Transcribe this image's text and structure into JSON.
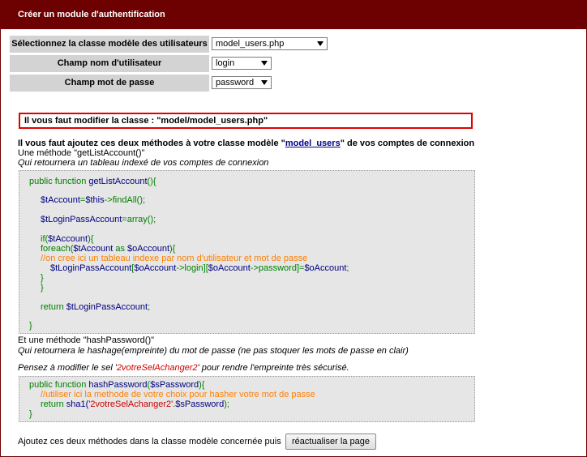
{
  "header": {
    "title": "Créer un module d'authentification"
  },
  "form": {
    "model_label": "Sélectionnez la classe modèle des utilisateurs",
    "model_value": "model_users.php",
    "username_label": "Champ nom d'utilisateur",
    "username_value": "login",
    "password_label": "Champ mot de passe",
    "password_value": "password"
  },
  "warning": "Il vous faut modifier la classe : \"model/model_users.php\"",
  "intro": {
    "part1": "Il vous faut ajoutez ces deux méthodes à votre classe modèle \"",
    "link": "model_users",
    "part2": "\" de vos comptes de connexion",
    "method1_title": "Une méthode \"getListAccount()\"",
    "method1_desc": "Qui retournera un tableau indexé de vos comptes de connexion"
  },
  "code1": {
    "l1a": "public function ",
    "l1b": "getListAccount",
    "l1c": "(){",
    "l2a": "$tAccount",
    "l2b": "=",
    "l2c": "$this",
    "l2d": "->findAll();",
    "l3a": "$tLoginPassAccount",
    "l3b": "=array();",
    "l4a": "if(",
    "l4b": "$tAccount",
    "l4c": "){",
    "l5a": "foreach(",
    "l5b": "$tAccount",
    "l5c": " as ",
    "l5d": "$oAccount",
    "l5e": "){",
    "l6": "//on cree ici un tableau indexe par nom d'utilisateur et mot de passe",
    "l7a": "$tLoginPassAccount",
    "l7b": "[",
    "l7c": "$oAccount",
    "l7d": "->login][",
    "l7e": "$oAccount",
    "l7f": "->password]=",
    "l7g": "$oAccount",
    "l7h": ";",
    "l8": "}",
    "l9": "}",
    "l10a": "return ",
    "l10b": "$tLoginPassAccount",
    "l10c": ";",
    "l11": "}"
  },
  "method2": {
    "title": "Et une méthode \"hashPassword()\"",
    "desc": "Qui retournera le hashage(empreinte) du mot de passe (ne pas stoquer les mots de passe en clair)",
    "salt_a": "Pensez à modifier le sel '",
    "salt_b": "2votreSelAchanger2",
    "salt_c": "' pour rendre l'empreinte très sécurisé."
  },
  "code2": {
    "l1a": "public function ",
    "l1b": "hashPassword",
    "l1c": "(",
    "l1d": "$sPassword",
    "l1e": "){",
    "l2": "//utiliser ici la methode de votre choix pour hasher votre mot de passe",
    "l3a": "return ",
    "l3b": "sha1(",
    "l3c": "'2votreSelAchanger2'",
    "l3d": ".",
    "l3e": "$sPassword",
    "l3f": ");",
    "l4": "}"
  },
  "footer": {
    "text": "Ajoutez ces deux méthodes dans la classe modèle concernée puis",
    "button": "réactualiser la page"
  }
}
